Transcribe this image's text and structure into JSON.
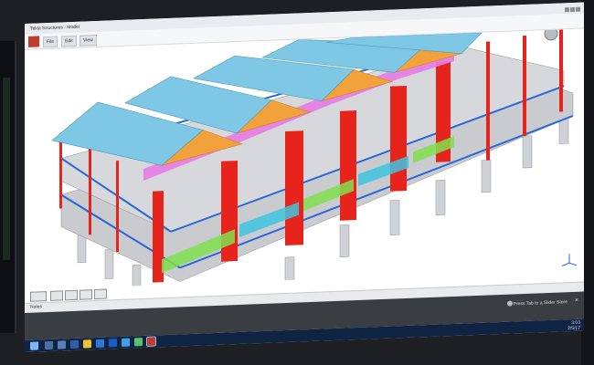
{
  "app": {
    "title": "Tekla Structures - Model",
    "ribbon_tabs": [
      "File",
      "Edit",
      "View"
    ]
  },
  "viewport": {
    "model": "3d-building-structure",
    "colors": {
      "roof": "#7ec8e6",
      "truss_orange": "#f2a23a",
      "truss_pink": "#e87ce4",
      "column_red": "#e6241b",
      "beam_blue": "#2a67d8",
      "slab_gray": "#c7c9cc",
      "pier_gray": "#cfd1d4",
      "green_brace": "#7fe04c",
      "cyan_brace": "#3ec6e0"
    }
  },
  "status": {
    "label": "Notes"
  },
  "notification": {
    "text": "Press Tab to a Slider Store"
  },
  "taskbar": {
    "clock": "3:03\n2/5/17"
  }
}
